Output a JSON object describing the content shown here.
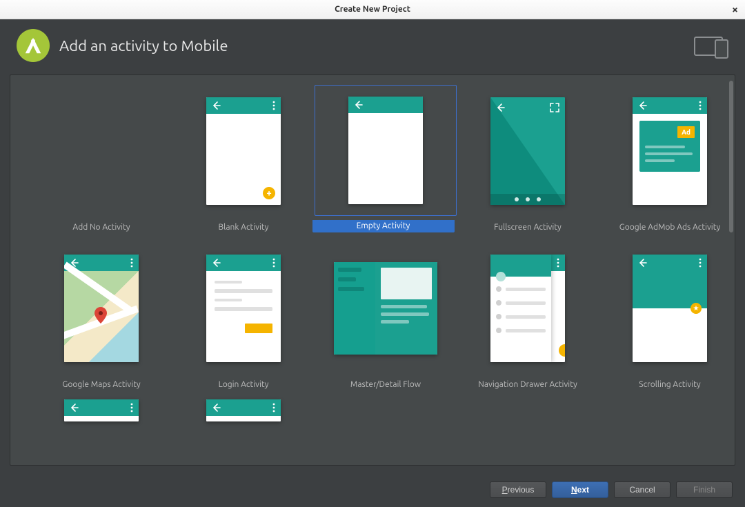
{
  "window": {
    "title": "Create New Project"
  },
  "header": {
    "heading": "Add an activity to Mobile"
  },
  "templates": {
    "addNone": "Add No Activity",
    "blank": "Blank Activity",
    "empty": "Empty Activity",
    "fullscreen": "Fullscreen Activity",
    "admob": "Google AdMob Ads Activity",
    "maps": "Google Maps Activity",
    "login": "Login Activity",
    "masterDetail": "Master/Detail Flow",
    "navDrawer": "Navigation Drawer Activity",
    "scrolling": "Scrolling Activity",
    "adLabel": "Ad"
  },
  "selected": "empty",
  "buttons": {
    "previous": "Previous",
    "next": "Next",
    "cancel": "Cancel",
    "finish": "Finish"
  },
  "colors": {
    "brandGreen": "#a4c639",
    "teal": "#1ba090",
    "accentBlue": "#3170c9",
    "accentYellow": "#f5b400",
    "darkBg": "#3c3f41",
    "panelBg": "#45494a"
  }
}
